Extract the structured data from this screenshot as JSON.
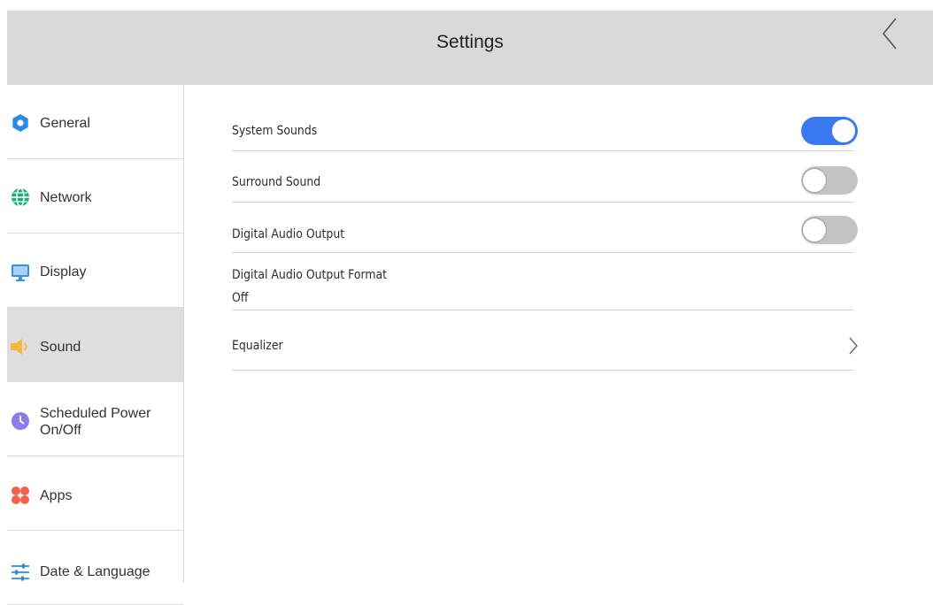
{
  "header": {
    "title": "Settings",
    "back_icon": "chevron-left-icon"
  },
  "sidebar": {
    "items": [
      {
        "label": "General",
        "icon": "gear-icon",
        "color": "#2a8be0"
      },
      {
        "label": "Network",
        "icon": "globe-icon",
        "color": "#1fae7a"
      },
      {
        "label": "Display",
        "icon": "monitor-icon",
        "color": "#3d8fe0"
      },
      {
        "label": "Sound",
        "icon": "speaker-icon",
        "color": "#f4b740",
        "active": true
      },
      {
        "label_line1": "Scheduled Power",
        "label_line2": "On/Off",
        "icon": "clock-icon",
        "color": "#8c7de8"
      },
      {
        "label": "Apps",
        "icon": "apps-icon",
        "color": "#f0634a"
      },
      {
        "label": "Date & Language",
        "icon": "sliders-icon",
        "color": "#2a8be0"
      }
    ]
  },
  "sound": {
    "system_sounds": {
      "label": "System Sounds",
      "enabled": true
    },
    "surround_sound": {
      "label": "Surround Sound",
      "enabled": false
    },
    "digital_audio_output": {
      "label": "Digital Audio Output",
      "enabled": false
    },
    "digital_audio_output_format": {
      "label": "Digital Audio Output Format",
      "value": "Off"
    },
    "equalizer": {
      "label": "Equalizer",
      "icon": "chevron-right-icon"
    }
  },
  "colors": {
    "accent": "#3a78f0",
    "toggle_off": "#c4c4c4",
    "header_bg": "#d9d9d9",
    "active_item_bg": "#dedede"
  }
}
